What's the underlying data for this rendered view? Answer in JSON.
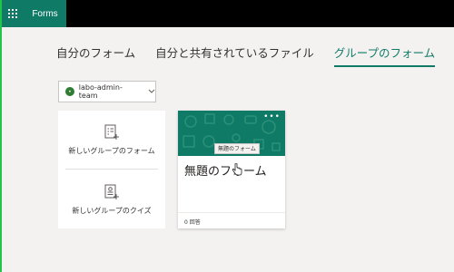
{
  "app": {
    "name": "Forms"
  },
  "tabs": [
    {
      "label": "自分のフォーム",
      "active": false
    },
    {
      "label": "自分と共有されているファイル",
      "active": false
    },
    {
      "label": "グループのフォーム",
      "active": true
    }
  ],
  "team_select": {
    "value": "labo-admin-team",
    "avatar_letter": "•"
  },
  "new_items": [
    {
      "label": "新しいグループのフォーム",
      "icon": "new-form-icon"
    },
    {
      "label": "新しいグループのクイズ",
      "icon": "new-quiz-icon"
    }
  ],
  "form_card": {
    "title": "無題のフォーム",
    "tooltip": "無題のフォーム",
    "responses": "0 回答",
    "more": "•••"
  },
  "colors": {
    "accent": "#0f7b66",
    "topbar": "#000000",
    "background": "#f3f2f1"
  }
}
